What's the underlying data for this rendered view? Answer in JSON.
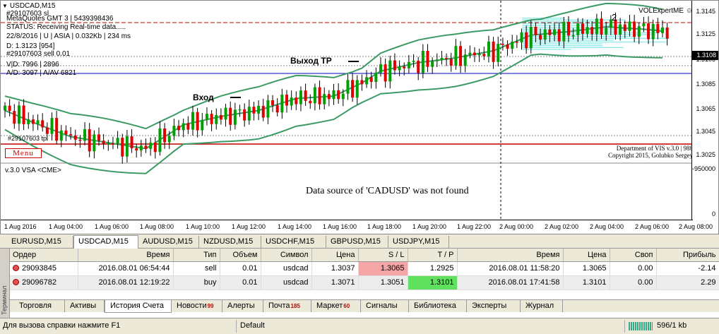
{
  "chart": {
    "title": "USDCAD,M15",
    "info_lines": [
      "#29107603 sl",
      "MetaQuotes GMT 3 | 5439398436",
      "STATUS:  Receiving Real-time data.....",
      "22/8/2016 | U | ASIA | 0.032Kb | 234 ms",
      "D: 1.3123  [954]",
      "#29107603 sell 0.01",
      "V|D: 7996 | 2896",
      "A/D: 3097 | A/AV 6821"
    ],
    "indicator_label": "VOLExpertME",
    "price_ticks": [
      "1.3145",
      "1.3125",
      "1.3105",
      "1.3085",
      "1.3065",
      "1.3045",
      "1.3025"
    ],
    "current_price": "1.3108",
    "time_ticks": [
      "1 Aug 2016",
      "1 Aug 04:00",
      "1 Aug 06:00",
      "1 Aug 08:00",
      "1 Aug 10:00",
      "1 Aug 12:00",
      "1 Aug 14:00",
      "1 Aug 16:00",
      "1 Aug 18:00",
      "1 Aug 20:00",
      "1 Aug 22:00",
      "2 Aug 00:00",
      "2 Aug 02:00",
      "2 Aug 04:00",
      "2 Aug 06:00",
      "2 Aug 08:00"
    ],
    "annotations": {
      "entry": "Вход",
      "exit": "Выход  ТР",
      "wave": "2",
      "tp_label": "#29107603 tp"
    },
    "copyright": [
      "Department of VIS  v.3.0 | 988",
      "Copyright 2015, Golubko Sergey"
    ],
    "menu_button": "Menu",
    "subwindow": {
      "title": "v.3.0 VSA  <CME>",
      "message": "Data source of 'CADUSD' was not found",
      "max_label": "-950000",
      "zero_label": "0"
    },
    "colors": {
      "up": "#00a000",
      "down": "#e00000",
      "band": "#3c9a64",
      "fill": "#7fe8e8",
      "red_line": "#c00000",
      "blue_line": "#0000c0"
    }
  },
  "symbol_tabs": [
    {
      "label": "EURUSD,M15",
      "active": false
    },
    {
      "label": "USDCAD,M15",
      "active": true
    },
    {
      "label": "AUDUSD,M15",
      "active": false
    },
    {
      "label": "NZDUSD,M15",
      "active": false
    },
    {
      "label": "USDCHF,M15",
      "active": false
    },
    {
      "label": "GBPUSD,M15",
      "active": false
    },
    {
      "label": "USDJPY,M15",
      "active": false
    }
  ],
  "terminal_label": "Терминал",
  "orders": {
    "headers": [
      "Ордер",
      "Время",
      "Тип",
      "Объем",
      "Символ",
      "Цена",
      "S / L",
      "T / P",
      "Время",
      "Цена",
      "Своп",
      "Прибыль"
    ],
    "rows": [
      [
        "29093845",
        "2016.08.01 06:54:44",
        "sell",
        "0.01",
        "usdcad",
        "1.3037",
        "1.3065",
        "1.2925",
        "2016.08.01 11:58:20",
        "1.3065",
        "0.00",
        "-2.14"
      ],
      [
        "29096782",
        "2016.08.01 12:19:22",
        "buy",
        "0.01",
        "usdcad",
        "1.3071",
        "1.3051",
        "1.3101",
        "2016.08.01 17:41:58",
        "1.3101",
        "0.00",
        "2.29"
      ]
    ]
  },
  "bottom_tabs": [
    {
      "label": "Торговля",
      "badge": ""
    },
    {
      "label": "Активы",
      "badge": ""
    },
    {
      "label": "История Счета",
      "badge": "",
      "active": true
    },
    {
      "label": "Новости",
      "badge": "99"
    },
    {
      "label": "Алерты",
      "badge": ""
    },
    {
      "label": "Почта",
      "badge": "185"
    },
    {
      "label": "Маркет",
      "badge": "60"
    },
    {
      "label": "Сигналы",
      "badge": ""
    },
    {
      "label": "Библиотека",
      "badge": ""
    },
    {
      "label": "Эксперты",
      "badge": ""
    },
    {
      "label": "Журнал",
      "badge": ""
    }
  ],
  "status": {
    "help": "Для вызова справки нажмите F1",
    "profile": "Default",
    "connection": "596/1 kb"
  }
}
